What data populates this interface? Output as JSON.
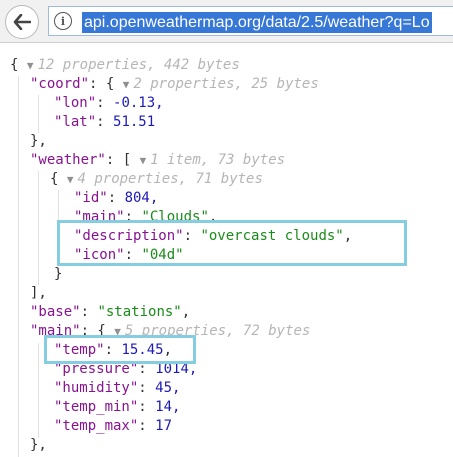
{
  "toolbar": {
    "url": "api.openweathermap.org/data/2.5/weather?q=Lo",
    "info_glyph": "i"
  },
  "json": {
    "root_open": "{",
    "root_meta": "12 properties, 442 bytes",
    "coord": {
      "key": "\"coord\"",
      "meta": "2 properties, 25 bytes",
      "lon_key": "\"lon\"",
      "lon_val": "-0.13,",
      "lat_key": "\"lat\"",
      "lat_val": "51.51",
      "close": "},"
    },
    "weather": {
      "key": "\"weather\"",
      "meta": "1 item, 73 bytes",
      "item_meta": "4 properties, 71 bytes",
      "id_key": "\"id\"",
      "id_val": "804,",
      "main_key": "\"main\"",
      "main_val": "\"Clouds\"",
      "description_key": "\"description\"",
      "description_val": "\"overcast clouds\"",
      "icon_key": "\"icon\"",
      "icon_val": "\"04d\"",
      "item_close": "}",
      "close": "],"
    },
    "base": {
      "key": "\"base\"",
      "val": "\"stations\""
    },
    "main": {
      "key": "\"main\"",
      "meta": "5 properties, 72 bytes",
      "temp_key": "\"temp\"",
      "temp_val": "15.45",
      "pressure_key": "\"pressure\"",
      "pressure_val": "1014,",
      "humidity_key": "\"humidity\"",
      "humidity_val": "45,",
      "temp_min_key": "\"temp_min\"",
      "temp_min_val": "14,",
      "temp_max_key": "\"temp_max\"",
      "temp_max_val": "17",
      "close": "},"
    }
  },
  "colors": {
    "key": "#881391",
    "string": "#1a8c1a",
    "number": "#1d1ab8",
    "highlight": "#85cde0",
    "url_selection": "#3777d6"
  }
}
